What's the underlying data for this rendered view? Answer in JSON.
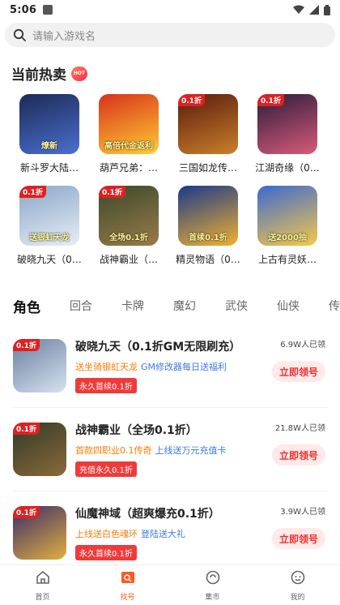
{
  "status": {
    "time": "5:06"
  },
  "search": {
    "placeholder": "请输入游戏名"
  },
  "hot": {
    "title": "当前热卖",
    "badge": "HOT",
    "games": [
      {
        "name": "新斗罗大陆…",
        "tag": "",
        "foot": "燎新",
        "colors": [
          "#1c2a55",
          "#4b6fd1"
        ]
      },
      {
        "name": "葫芦兄弟：…",
        "tag": "",
        "foot": "高倍代金返利",
        "colors": [
          "#d8321c",
          "#ffcc33"
        ]
      },
      {
        "name": "三国如龙传…",
        "tag": "0.1折",
        "foot": "",
        "colors": [
          "#5a1a0e",
          "#c9802a"
        ]
      },
      {
        "name": "江湖奇缘（0…",
        "tag": "0.1折",
        "foot": "",
        "colors": [
          "#2a1c3a",
          "#d85a7a"
        ]
      },
      {
        "name": "破晓九天（0…",
        "tag": "0.1折",
        "foot": "送银虹天龙",
        "colors": [
          "#8aa6c8",
          "#e7eef6"
        ]
      },
      {
        "name": "战神霸业（…",
        "tag": "0.1折",
        "foot": "全场0.1折",
        "colors": [
          "#3a4a2a",
          "#9a7a4a"
        ]
      },
      {
        "name": "精灵物语（0…",
        "tag": "",
        "foot": "首续0.1折",
        "colors": [
          "#1a3a8a",
          "#f0b030"
        ]
      },
      {
        "name": "上古有灵妖…",
        "tag": "",
        "foot": "送2000抽",
        "colors": [
          "#3a6ad0",
          "#f7c84a"
        ]
      }
    ]
  },
  "tabs": [
    "角色",
    "回合",
    "卡牌",
    "魔幻",
    "武侠",
    "仙侠",
    "传"
  ],
  "list": [
    {
      "title": "破晓九天（0.1折GM无限刷充）",
      "sub_a": "送坐骑银虹天龙",
      "sub_b": "GM修改器每日送福利",
      "pill": "永久首续0.1折",
      "count": "6.9W人已领",
      "button": "立即领号",
      "tag": "0.1折",
      "colors": [
        "#6a7fa0",
        "#d6e2f0"
      ]
    },
    {
      "title": "战神霸业（全场0.1折）",
      "sub_a": "首款四职业0.1传奇",
      "sub_b": "上线送万元充值卡",
      "pill": "充值永久0.1折",
      "count": "21.8W人已领",
      "button": "立即领号",
      "tag": "0.1折",
      "colors": [
        "#2f3a28",
        "#8b6a3a"
      ]
    },
    {
      "title": "仙魔神域（超爽爆充0.1折）",
      "sub_a": "上线送白色魂环",
      "sub_b": "登陆送大礼",
      "pill": "永久首续0.1折",
      "count": "3.9W人已领",
      "button": "立即领号",
      "tag": "0.1折",
      "colors": [
        "#3a2a6a",
        "#e0b040"
      ]
    }
  ],
  "tabbar": [
    {
      "label": "首页",
      "icon": "home-icon",
      "active": false
    },
    {
      "label": "找号",
      "icon": "search-account-icon",
      "active": true
    },
    {
      "label": "集市",
      "icon": "market-icon",
      "active": false
    },
    {
      "label": "我的",
      "icon": "profile-icon",
      "active": false
    }
  ],
  "colors": {
    "accent": "#ff3b3b",
    "orange": "#ff7a00",
    "blue": "#3b7ae0"
  }
}
